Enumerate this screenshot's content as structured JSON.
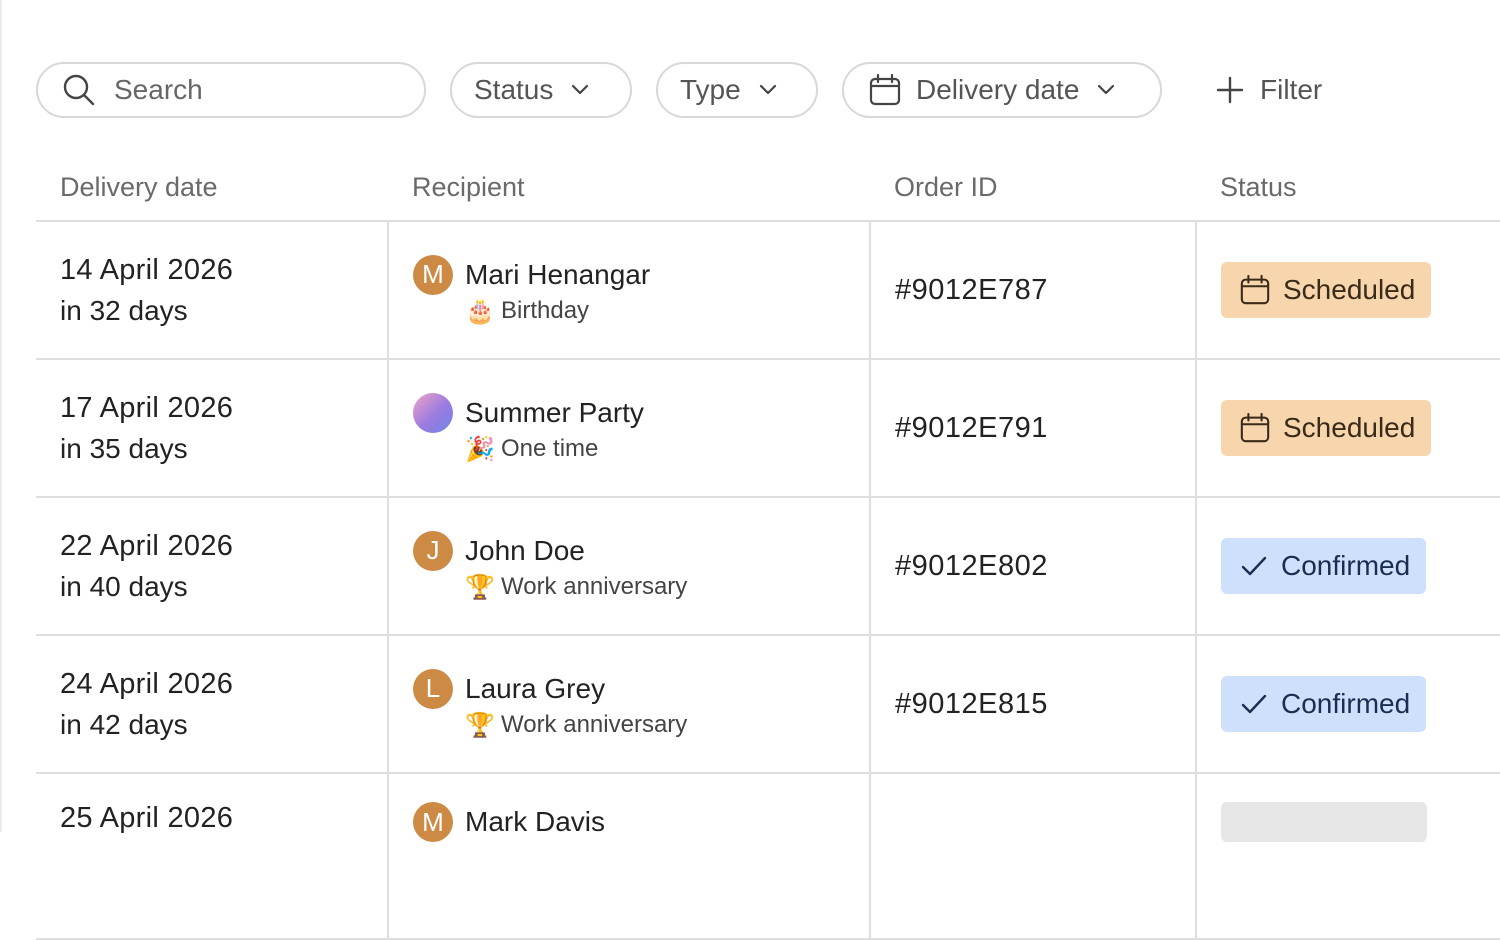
{
  "filters": {
    "search_placeholder": "Search",
    "status_label": "Status",
    "type_label": "Type",
    "date_label": "Delivery date",
    "add_filter_label": "Filter"
  },
  "table": {
    "headers": [
      "Delivery date",
      "Recipient",
      "Order ID",
      "Status"
    ],
    "rows": [
      {
        "date": "14 April 2026",
        "relative": "in 32 days",
        "avatar": "M",
        "avatar_style": "letter",
        "name": "Mari Henangar",
        "type_emoji": "🎂",
        "type": "Birthday",
        "order_id": "#9012E787",
        "status": "Scheduled",
        "status_kind": "scheduled"
      },
      {
        "date": "17 April 2026",
        "relative": "in 35 days",
        "avatar": "",
        "avatar_style": "gradient",
        "name": "Summer Party",
        "type_emoji": "🎉",
        "type": "One time",
        "order_id": "#9012E791",
        "status": "Scheduled",
        "status_kind": "scheduled"
      },
      {
        "date": "22 April 2026",
        "relative": "in 40 days",
        "avatar": "J",
        "avatar_style": "letter",
        "name": "John Doe",
        "type_emoji": "🏆",
        "type": "Work anniversary",
        "order_id": "#9012E802",
        "status": "Confirmed",
        "status_kind": "confirmed"
      },
      {
        "date": "24 April 2026",
        "relative": "in 42 days",
        "avatar": "L",
        "avatar_style": "letter",
        "name": "Laura Grey",
        "type_emoji": "🏆",
        "type": "Work anniversary",
        "order_id": "#9012E815",
        "status": "Confirmed",
        "status_kind": "confirmed"
      },
      {
        "date": "25 April 2026",
        "avatar": "M",
        "avatar_style": "letter",
        "name": "Mark Davis"
      }
    ]
  },
  "colors": {
    "scheduled_bg": "#f7d6ae",
    "confirmed_bg": "#cfe0fc",
    "avatar_bg": "#cc8a45"
  }
}
